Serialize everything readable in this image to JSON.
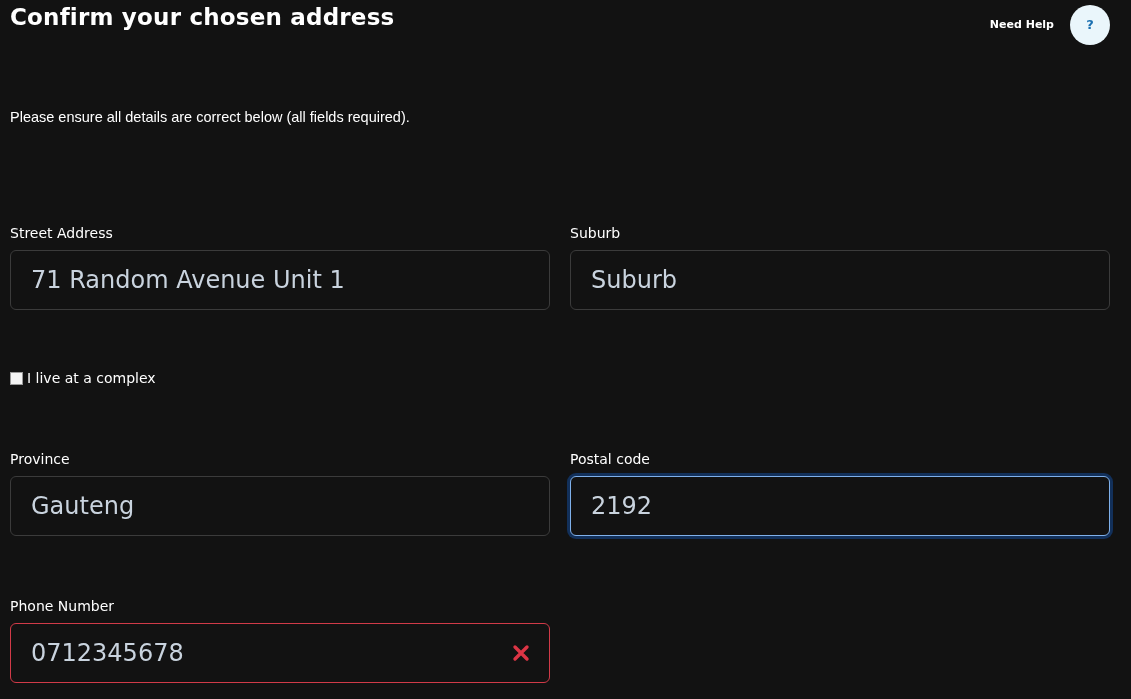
{
  "header": {
    "title": "Confirm your chosen address",
    "help_label": "Need Help",
    "help_button": "?"
  },
  "intro": "Please ensure all details are correct below (all fields required).",
  "sections": [
    {
      "kind": "fields",
      "fields": [
        {
          "label": "Street Address",
          "value": "71 Random Avenue Unit 1",
          "focused": false,
          "invalid": false
        },
        {
          "label": "Suburb",
          "placeholder": "Suburb",
          "focused": false,
          "invalid": false
        }
      ]
    },
    {
      "kind": "checkbox",
      "label": "I live at a complex",
      "checked": false
    },
    {
      "kind": "fields",
      "fields": [
        {
          "label": "Province",
          "value": "Gauteng",
          "focused": false,
          "invalid": false
        },
        {
          "label": "Postal code",
          "value": "2192",
          "focused": true,
          "invalid": false
        }
      ]
    },
    {
      "kind": "fields",
      "fields": [
        {
          "label": "Phone Number",
          "value": "0712345678",
          "focused": false,
          "invalid": true
        }
      ]
    }
  ]
}
